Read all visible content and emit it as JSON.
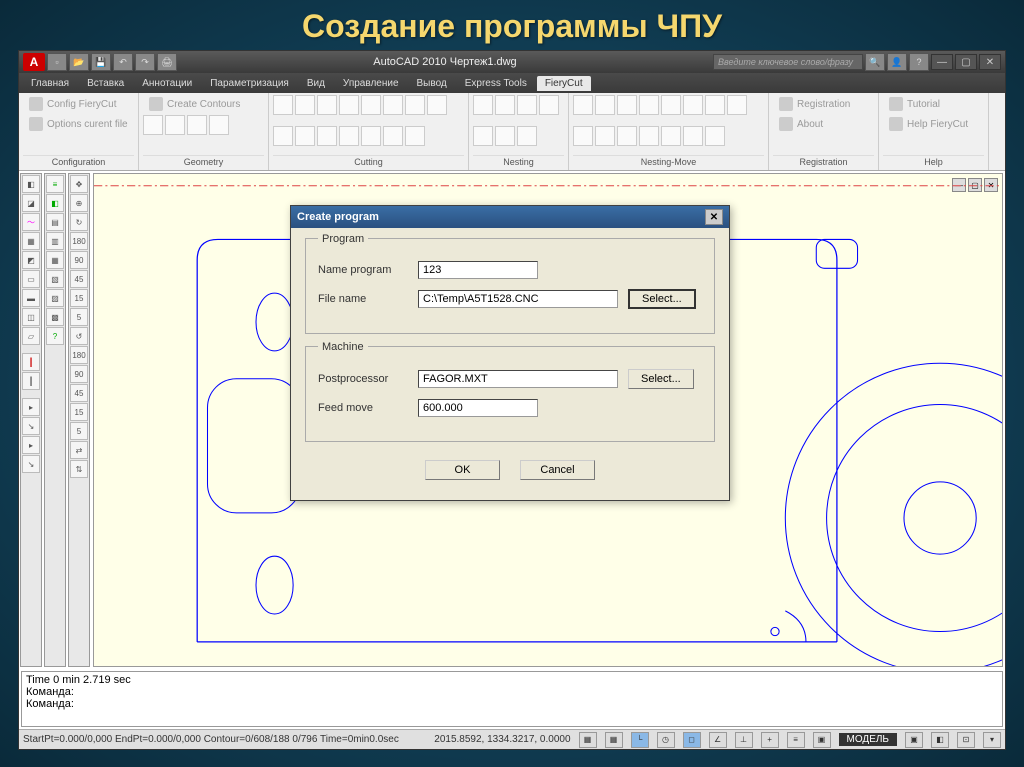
{
  "slide_title": "Создание программы ЧПУ",
  "app": {
    "title": "AutoCAD 2010   Чертеж1.dwg",
    "search_placeholder": "Введите ключевое слово/фразу"
  },
  "menu": {
    "items": [
      "Главная",
      "Вставка",
      "Аннотации",
      "Параметризация",
      "Вид",
      "Управление",
      "Вывод",
      "Express Tools",
      "FieryCut"
    ],
    "active": "FieryCut"
  },
  "ribbon": {
    "panels": [
      {
        "label": "Configuration",
        "text_btns": [
          "Config FieryCut",
          "Options curent file"
        ]
      },
      {
        "label": "Geometry",
        "text_btns": [
          "Create Contours"
        ]
      },
      {
        "label": "Cutting"
      },
      {
        "label": "Nesting"
      },
      {
        "label": "Nesting-Move"
      },
      {
        "label": "Registration",
        "text_btns": [
          "Registration",
          "About"
        ]
      },
      {
        "label": "Help",
        "text_btns": [
          "Tutorial",
          "Help FieryCut"
        ]
      }
    ]
  },
  "dialog": {
    "title": "Create program",
    "program_group": "Program",
    "machine_group": "Machine",
    "name_label": "Name program",
    "name_value": "123",
    "file_label": "File name",
    "file_value": "C:\\Temp\\A5T1528.CNC",
    "file_select": "Select...",
    "post_label": "Postprocessor",
    "post_value": "FAGOR.MXT",
    "post_select": "Select...",
    "feed_label": "Feed move",
    "feed_value": "600.000",
    "ok": "OK",
    "cancel": "Cancel"
  },
  "cmd": {
    "line1": "Time  0 min 2.719 sec",
    "line2": "Команда:",
    "line3": "Команда:"
  },
  "status": {
    "left": "StartPt=0.000/0,000  EndPt=0.000/0,000  Contour=0/608/188  0/796 Time=0min0.0sec",
    "coords": "2015.8592, 1334.3217, 0.0000",
    "model": "МОДЕЛЬ"
  }
}
